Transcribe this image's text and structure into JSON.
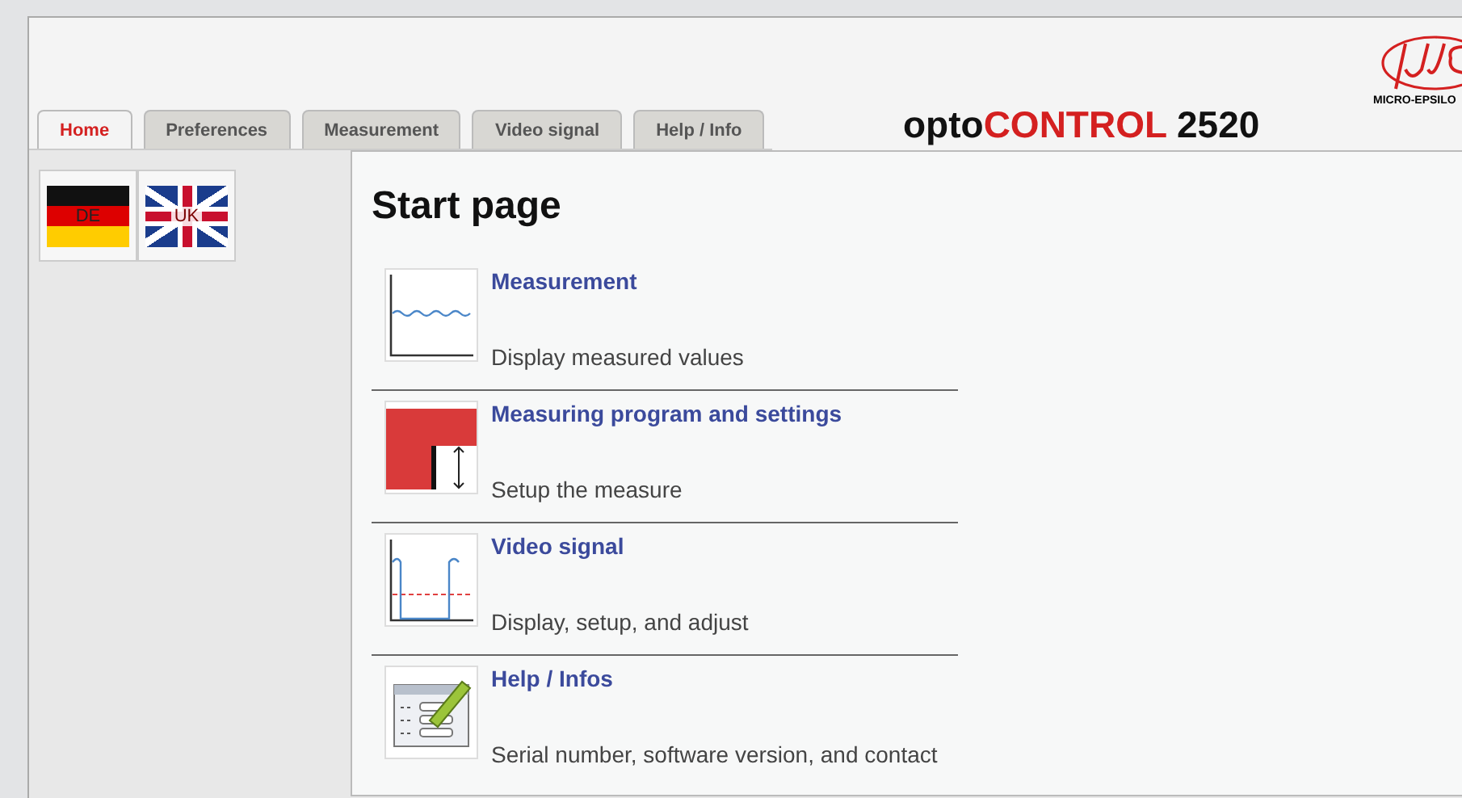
{
  "tabs": [
    {
      "label": "Home",
      "selected": true
    },
    {
      "label": "Preferences",
      "selected": false
    },
    {
      "label": "Measurement",
      "selected": false
    },
    {
      "label": "Video signal",
      "selected": false
    },
    {
      "label": "Help / Info",
      "selected": false
    }
  ],
  "product": {
    "prefix": "opto",
    "name": "CONTROL",
    "model": "2520"
  },
  "logo": {
    "caption": "MICRO-EPSILO"
  },
  "languages": [
    {
      "kind": "de",
      "code": "DE"
    },
    {
      "kind": "uk",
      "code": "UK"
    }
  ],
  "page": {
    "title": "Start page",
    "items": [
      {
        "kind": "measurement",
        "title": "Measurement",
        "description": "Display measured values"
      },
      {
        "kind": "settings",
        "title": "Measuring program and settings",
        "description": "Setup the measure"
      },
      {
        "kind": "video",
        "title": "Video signal",
        "description": "Display, setup, and adjust"
      },
      {
        "kind": "help",
        "title": "Help / Infos",
        "description": "Serial number, software version, and contact"
      }
    ]
  }
}
